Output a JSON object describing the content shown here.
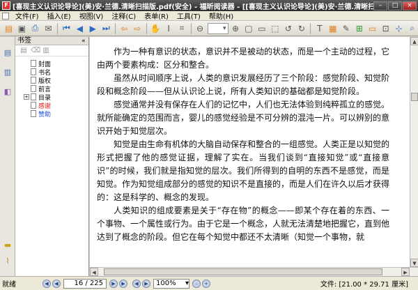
{
  "window": {
    "title": "[喜现主义认识论导论](美)安·兰德.清晰扫描版.pdf(安全) - 福昕阅读器 - [[喜现主义认识论导论](美)安·兰德.清晰扫描版.pdf(安全)]"
  },
  "menu": {
    "items": [
      "文件(F)",
      "插入(E)",
      "视图(V)",
      "注释(C)",
      "表单(R)",
      "工具(T)",
      "帮助(H)"
    ]
  },
  "toolbar": {
    "zoom_value": "▾"
  },
  "bookmarks": {
    "header": "书签",
    "items": [
      {
        "label": "封面",
        "style": "normal",
        "expandable": false
      },
      {
        "label": "书名",
        "style": "normal",
        "expandable": false
      },
      {
        "label": "版权",
        "style": "normal",
        "expandable": false
      },
      {
        "label": "前言",
        "style": "normal",
        "expandable": false
      },
      {
        "label": "目录",
        "style": "normal",
        "expandable": true
      },
      {
        "label": "感谢",
        "style": "red",
        "expandable": false
      },
      {
        "label": "赞助",
        "style": "blue",
        "expandable": false
      }
    ]
  },
  "document": {
    "paragraphs": [
      "作为一种有意识的状态，意识并不是被动的状态，而是一个主动的过程，它由两个要素构成：区分和整合。",
      "虽然从时间顺序上说，人类的意识发展经历了三个阶段：感觉阶段、知觉阶段和概念阶段——但从认识论上说，所有人类知识的基础都是知觉阶段。",
      "感觉通常并没有保存在人们的记忆中，人们也无法体验到纯粹孤立的感觉。就所能确定的范围而言，婴儿的感觉经验是不可分辨的混沌一片。可以辨别的意识开始于知觉层次。",
      "知觉是由生命有机体的大脑自动保存和整合的一组感觉。人类正是以知觉的形式把握了他的感觉证据，理解了实在。当我们谈到“直接知觉”或“直接意识”的时候，我们就是指知觉的层次。我们所得到的自明的东西不是感觉，而是知觉。作为知觉组成部分的感觉的知识不是直接的，而是人们在许久以后才获得的：这是科学的、概念的发现。",
      "人类知识的组成要素是关于“存在物”的概念——即某个存在着的东西、一个事物、一个属性或行为。由于它是一个概念，人就无法清楚地把握它，直到他达到了概念的阶段。但它在每个知觉中都还不太清晰（知觉一个事物，就"
    ]
  },
  "status": {
    "ready": "就绪",
    "page": "16 / 225",
    "zoom": "100%",
    "size": "文件: [21.00 * 29.71 厘米]"
  }
}
